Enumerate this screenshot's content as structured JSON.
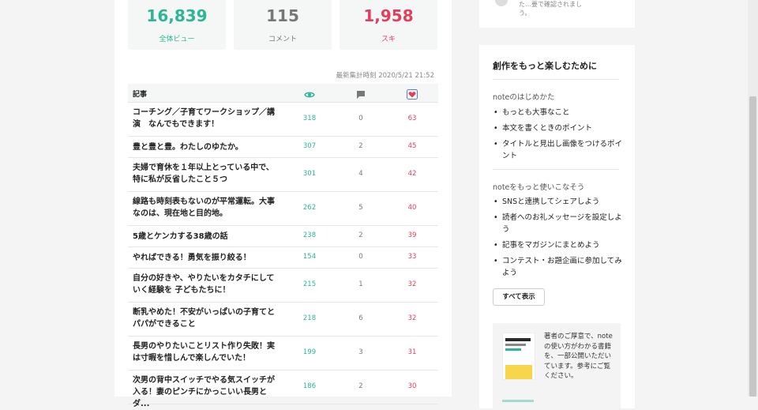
{
  "stats": {
    "views": {
      "value": "16,839",
      "label": "全体ビュー"
    },
    "comments": {
      "value": "115",
      "label": "コメント"
    },
    "likes": {
      "value": "1,958",
      "label": "スキ"
    }
  },
  "updated": "最新集計時刻 2020/5/21 21:52",
  "table": {
    "header": {
      "title": "記事"
    },
    "rows": [
      {
        "title": "コーチング／子育てワークショップ／講演　なんでもできます！",
        "views": "318",
        "comments": "0",
        "likes": "63"
      },
      {
        "title": "豊と豊と豊。わたしのゆたか。",
        "views": "307",
        "comments": "2",
        "likes": "45"
      },
      {
        "title": "夫婦で育休を１年以上とっている中で、特に私が反省したこと５つ",
        "views": "301",
        "comments": "4",
        "likes": "42"
      },
      {
        "title": "線路も時刻表もないのが平常運転。大事なのは、現在地と目的地。",
        "views": "262",
        "comments": "5",
        "likes": "40"
      },
      {
        "title": "5歳とケンカする38歳の話",
        "views": "238",
        "comments": "2",
        "likes": "39"
      },
      {
        "title": "やればできる！勇気を振り絞る！",
        "views": "154",
        "comments": "0",
        "likes": "33"
      },
      {
        "title": "自分の好きや、やりたいをカタチにしていく経験を 子どもたちに！",
        "views": "215",
        "comments": "1",
        "likes": "32"
      },
      {
        "title": "断乳やめた！不安がいっぱいの子育てとパパができること",
        "views": "218",
        "comments": "6",
        "likes": "32"
      },
      {
        "title": "長男のやりたいことリスト作り失敗！実は寸暇を惜しんで楽しんでいた！",
        "views": "199",
        "comments": "3",
        "likes": "31"
      },
      {
        "title": "次男の背中スイッチでやる気スイッチが入る！妻のピンチにかっこいい長男とダ...",
        "views": "186",
        "comments": "2",
        "likes": "30"
      }
    ]
  },
  "sidebar": {
    "top_text": "た…要で確認されまし\nう。",
    "heading": "創作をもっと楽しむために",
    "section1": {
      "label": "noteのはじめかた",
      "items": [
        "もっとも大事なこと",
        "本文を書くときのポイント",
        "タイトルと見出し画像をつけるポイント"
      ]
    },
    "section2": {
      "label": "noteをもっと使いこなそう",
      "items": [
        "SNSと連携してシェアしよう",
        "読者へのお礼メッセージを設定しよう",
        "記事をマガジンにまとめよう",
        "コンテスト・お題企画に参加してみよう"
      ]
    },
    "show_all": "すべて表示",
    "book_text": "著者のご厚意で、noteの使い方がわかる書籍を、一部公開いただいています。参考にご覧ください。"
  },
  "colors": {
    "accent": "#2cb696",
    "like": "#e0405f"
  }
}
